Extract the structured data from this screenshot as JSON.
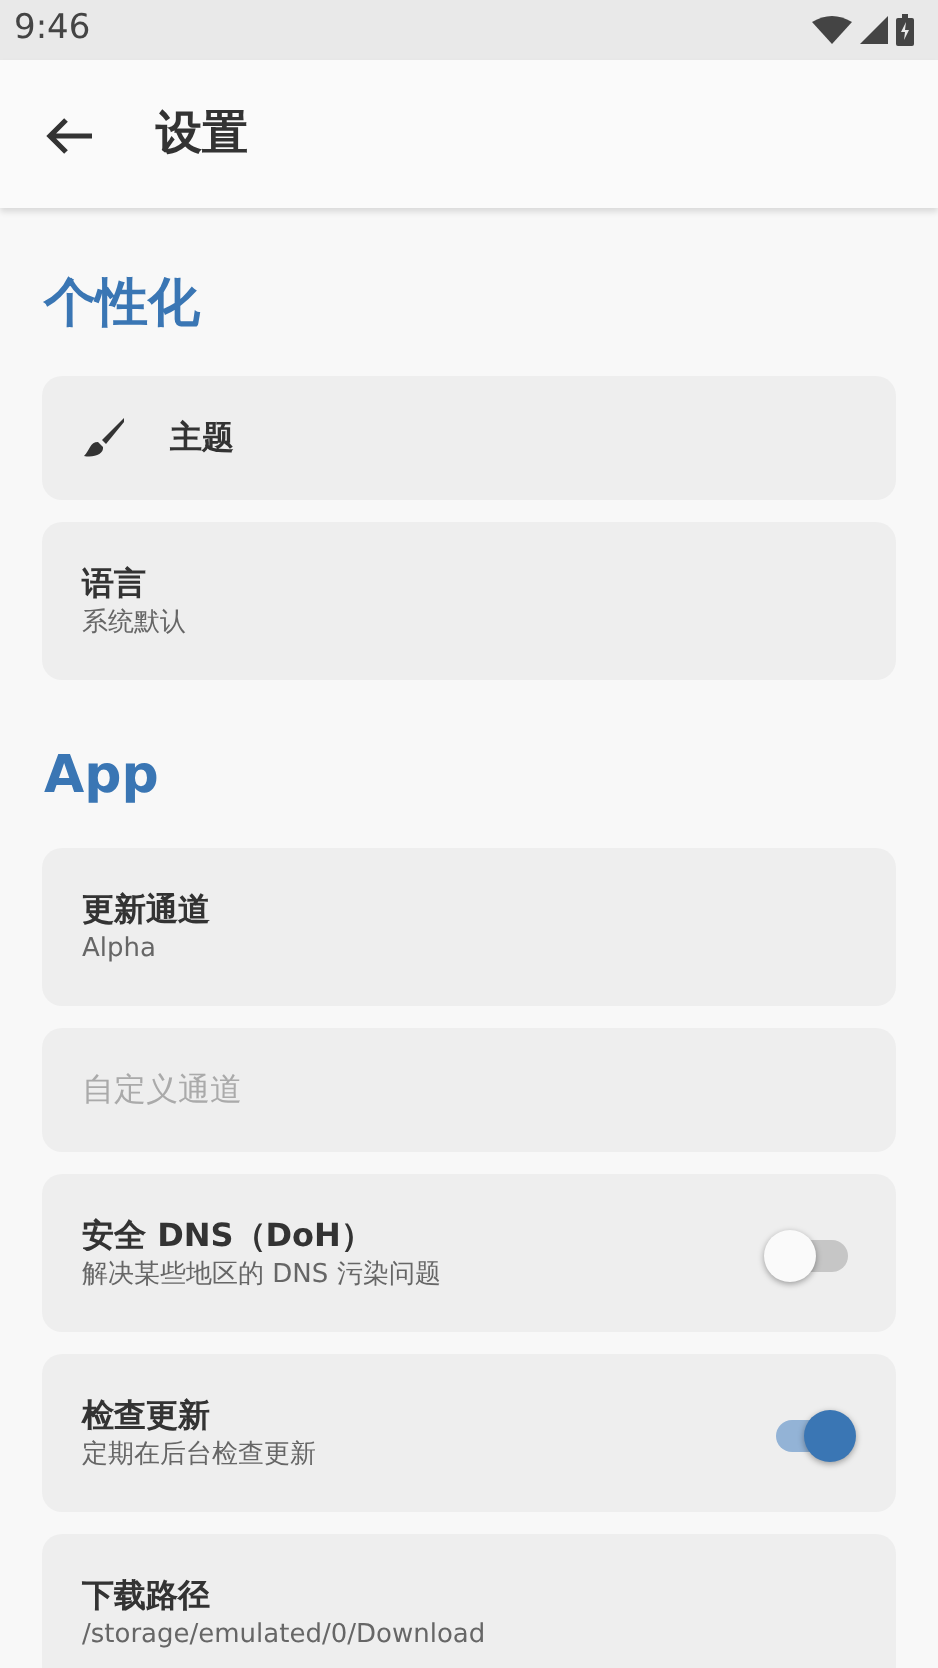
{
  "status_bar": {
    "time": "9:46"
  },
  "app_bar": {
    "title": "设置"
  },
  "sections": [
    {
      "title": "个性化",
      "items": [
        {
          "kind": "icon",
          "title": "主题",
          "disabled": false
        },
        {
          "kind": "text",
          "title": "语言",
          "subtitle": "系统默认",
          "disabled": false
        }
      ]
    },
    {
      "title": "App",
      "items": [
        {
          "kind": "text",
          "title": "更新通道",
          "subtitle": "Alpha",
          "disabled": false
        },
        {
          "kind": "text",
          "title": "自定义通道",
          "disabled": true
        },
        {
          "kind": "switch",
          "title": "安全 DNS（DoH）",
          "subtitle": "解决某些地区的 DNS 污染问题",
          "on": false,
          "disabled": false
        },
        {
          "kind": "switch",
          "title": "检查更新",
          "subtitle": "定期在后台检查更新",
          "on": true,
          "disabled": false
        },
        {
          "kind": "text",
          "title": "下载路径",
          "subtitle": "/storage/emulated/0/Download",
          "disabled": false
        }
      ]
    }
  ]
}
